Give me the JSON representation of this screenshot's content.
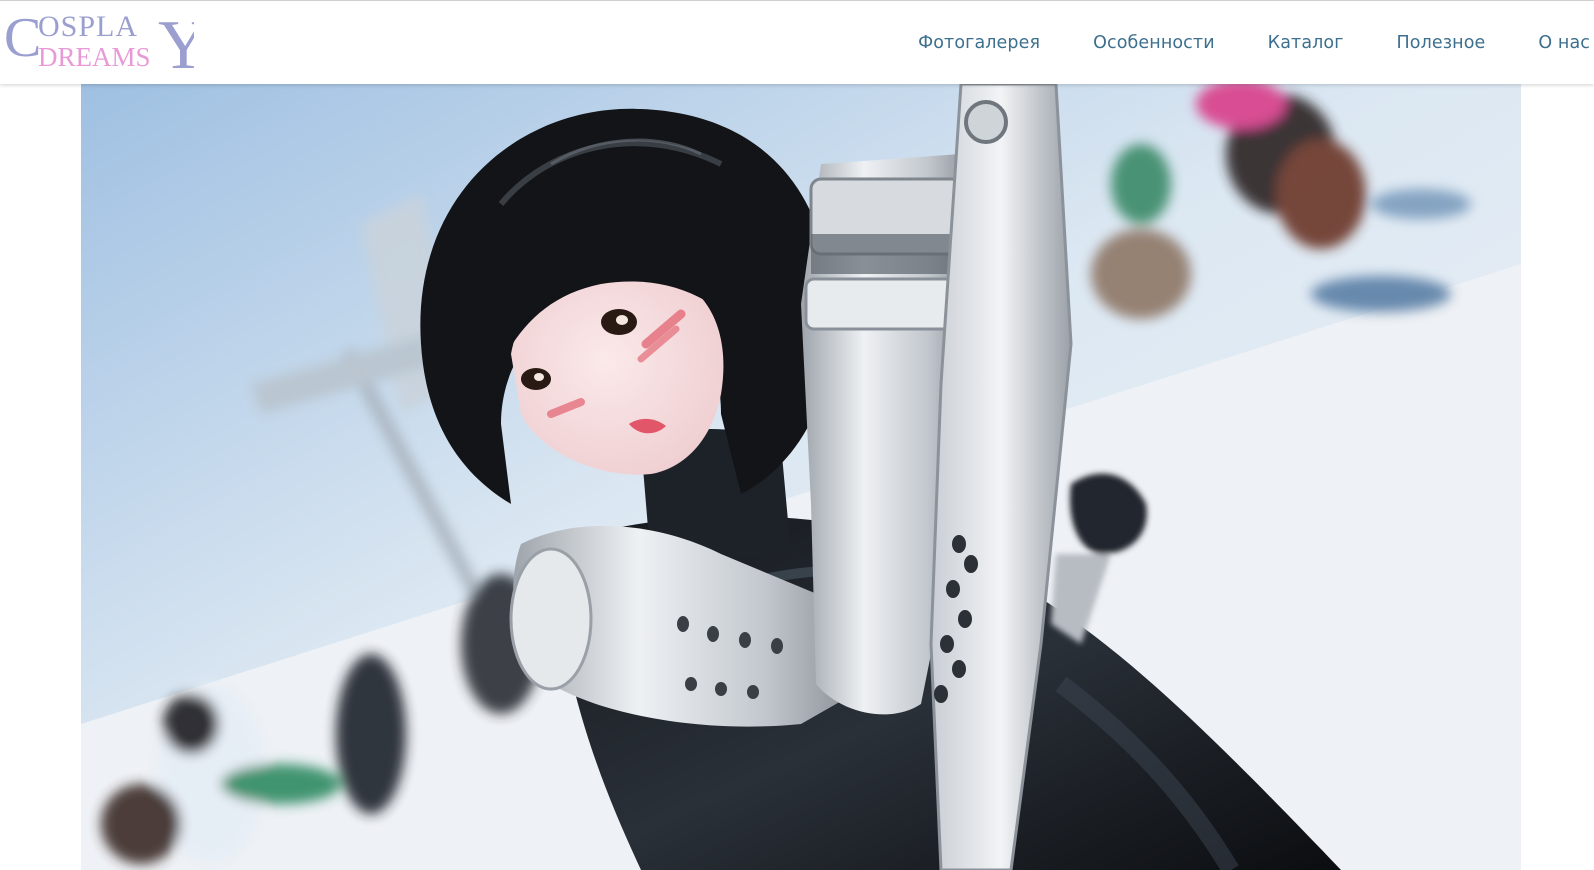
{
  "header": {
    "logo": {
      "line1": "COSPLAY",
      "line2": "DREAMS"
    },
    "nav": [
      {
        "label": "Фотогалерея"
      },
      {
        "label": "Особенности"
      },
      {
        "label": "Каталог"
      },
      {
        "label": "Полезное"
      },
      {
        "label": "О нас"
      }
    ]
  },
  "colors": {
    "nav_link": "#3d6f8e",
    "logo_primary": "#9a9fcf",
    "logo_accent": "#e89ad6"
  },
  "hero": {
    "icon": "cosplay-photo-image"
  }
}
